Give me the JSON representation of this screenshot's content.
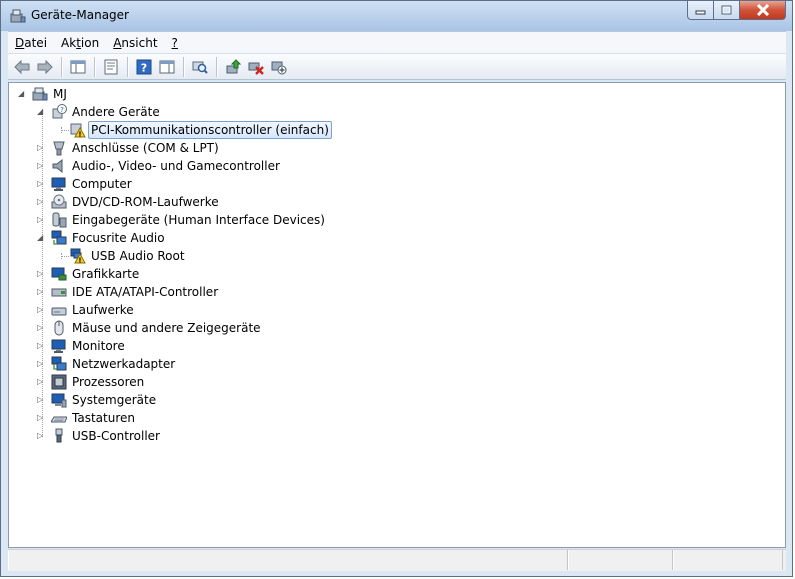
{
  "window": {
    "title": "Geräte-Manager",
    "icon": "device-manager-icon"
  },
  "menu": [
    {
      "pre": "",
      "key": "D",
      "post": "atei"
    },
    {
      "pre": "Ak",
      "key": "t",
      "post": "ion"
    },
    {
      "pre": "",
      "key": "A",
      "post": "nsicht"
    },
    {
      "pre": "",
      "key": "?",
      "post": ""
    }
  ],
  "toolbar": [
    "back-icon",
    "forward-icon",
    "show-hide-console-tree-icon",
    "properties-icon",
    "help-icon",
    "show-hide-action-pane-icon",
    "scan-hardware-icon",
    "update-driver-icon",
    "uninstall-icon",
    "disable-icon"
  ],
  "tree": {
    "root": "MJ",
    "andere": "Andere Geräte",
    "pci": "PCI-Kommunikationscontroller (einfach)",
    "anschluesse": "Anschlüsse (COM & LPT)",
    "audio": "Audio-, Video- und Gamecontroller",
    "computer": "Computer",
    "dvd": "DVD/CD-ROM-Laufwerke",
    "eingabe": "Eingabegeräte (Human Interface Devices)",
    "focusrite": "Focusrite Audio",
    "usbaudio": "USB Audio Root",
    "grafik": "Grafikkarte",
    "ide": "IDE ATA/ATAPI-Controller",
    "laufwerke": "Laufwerke",
    "maeuse": "Mäuse und andere Zeigegeräte",
    "monitore": "Monitore",
    "netzwerk": "Netzwerkadapter",
    "prozessoren": "Prozessoren",
    "system": "Systemgeräte",
    "tastaturen": "Tastaturen",
    "usb": "USB-Controller"
  }
}
